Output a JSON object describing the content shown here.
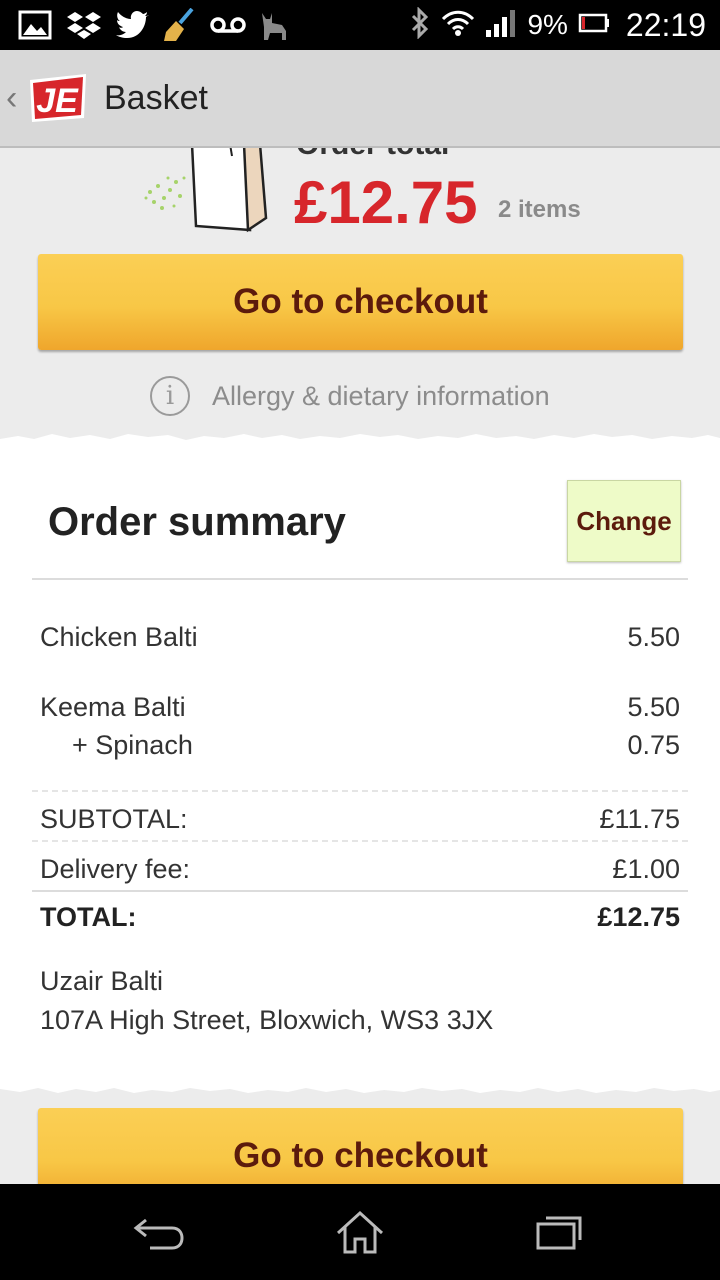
{
  "status_bar": {
    "icons": [
      "gallery-icon",
      "dropbox-icon",
      "twitter-icon",
      "broom-icon",
      "voicemail-icon",
      "cat-icon",
      "bluetooth-icon",
      "wifi-icon",
      "signal-icon",
      "battery-icon"
    ],
    "battery": "9%",
    "time": "22:19"
  },
  "action_bar": {
    "logo_text": "JE",
    "title": "Basket"
  },
  "order_total": {
    "label": "Order total",
    "amount": "£12.75",
    "count": "2 items"
  },
  "checkout": {
    "label": "Go to checkout"
  },
  "allergy": {
    "icon": "i",
    "label": "Allergy & dietary information"
  },
  "summary": {
    "title": "Order summary",
    "change_label": "Change",
    "items": [
      {
        "name": "Chicken Balti",
        "price": "5.50"
      },
      {
        "name": "Keema Balti",
        "price": "5.50"
      },
      {
        "name": "+ Spinach",
        "price": "0.75"
      }
    ],
    "subtotal_label": "SUBTOTAL:",
    "subtotal": "£11.75",
    "delivery_label": "Delivery fee:",
    "delivery": "£1.00",
    "total_label": "TOTAL:",
    "total": "£12.75"
  },
  "restaurant": {
    "name": "Uzair Balti",
    "address": "107A High Street, Bloxwich, WS3 3JX"
  },
  "colors": {
    "accent_red": "#d7262b",
    "button_gold": "#f8c746",
    "button_text": "#5c1b0c",
    "change_bg": "#eefbc8"
  }
}
